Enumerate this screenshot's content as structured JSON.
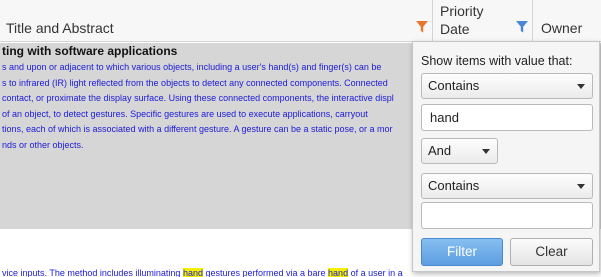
{
  "header": {
    "columns": [
      {
        "label": "Title and Abstract"
      },
      {
        "label": "Priority Date"
      },
      {
        "label": "Owner"
      }
    ],
    "filter_icon_colors": {
      "active": "#e8762d",
      "inactive": "#4a86d4"
    }
  },
  "rows": [
    {
      "title": "ting with software applications",
      "abstract_lines": [
        "s and upon or adjacent to which various objects, including a user's hand(s) and finger(s) can be",
        "s to infrared (IR) light reflected from the objects to detect any connected components. Connected",
        "contact, or proximate the display surface. Using these connected components, the interactive displ",
        "of an object, to detect gestures. Specific gestures are used to execute applications, carryout",
        "tions, each of which is associated with a different gesture. A gesture can be a static pose, or a mor",
        "nds or other objects."
      ]
    },
    {
      "abstract_parts": [
        "vice inputs. The method includes illuminating ",
        "hand",
        " gestures performed via a bare ",
        "hand",
        " of a user in a"
      ]
    }
  ],
  "filter_popup": {
    "prompt": "Show items with value that:",
    "condition1": "Contains",
    "value1": "hand",
    "operator": "And",
    "condition2": "Contains",
    "value2": "",
    "filter_button": "Filter",
    "clear_button": "Clear"
  },
  "colors": {
    "selected_row": "#d6d6d6",
    "abstract_text": "#1a1ad8",
    "highlight": "#f3f000",
    "filter_button": "#6aa9e8"
  }
}
